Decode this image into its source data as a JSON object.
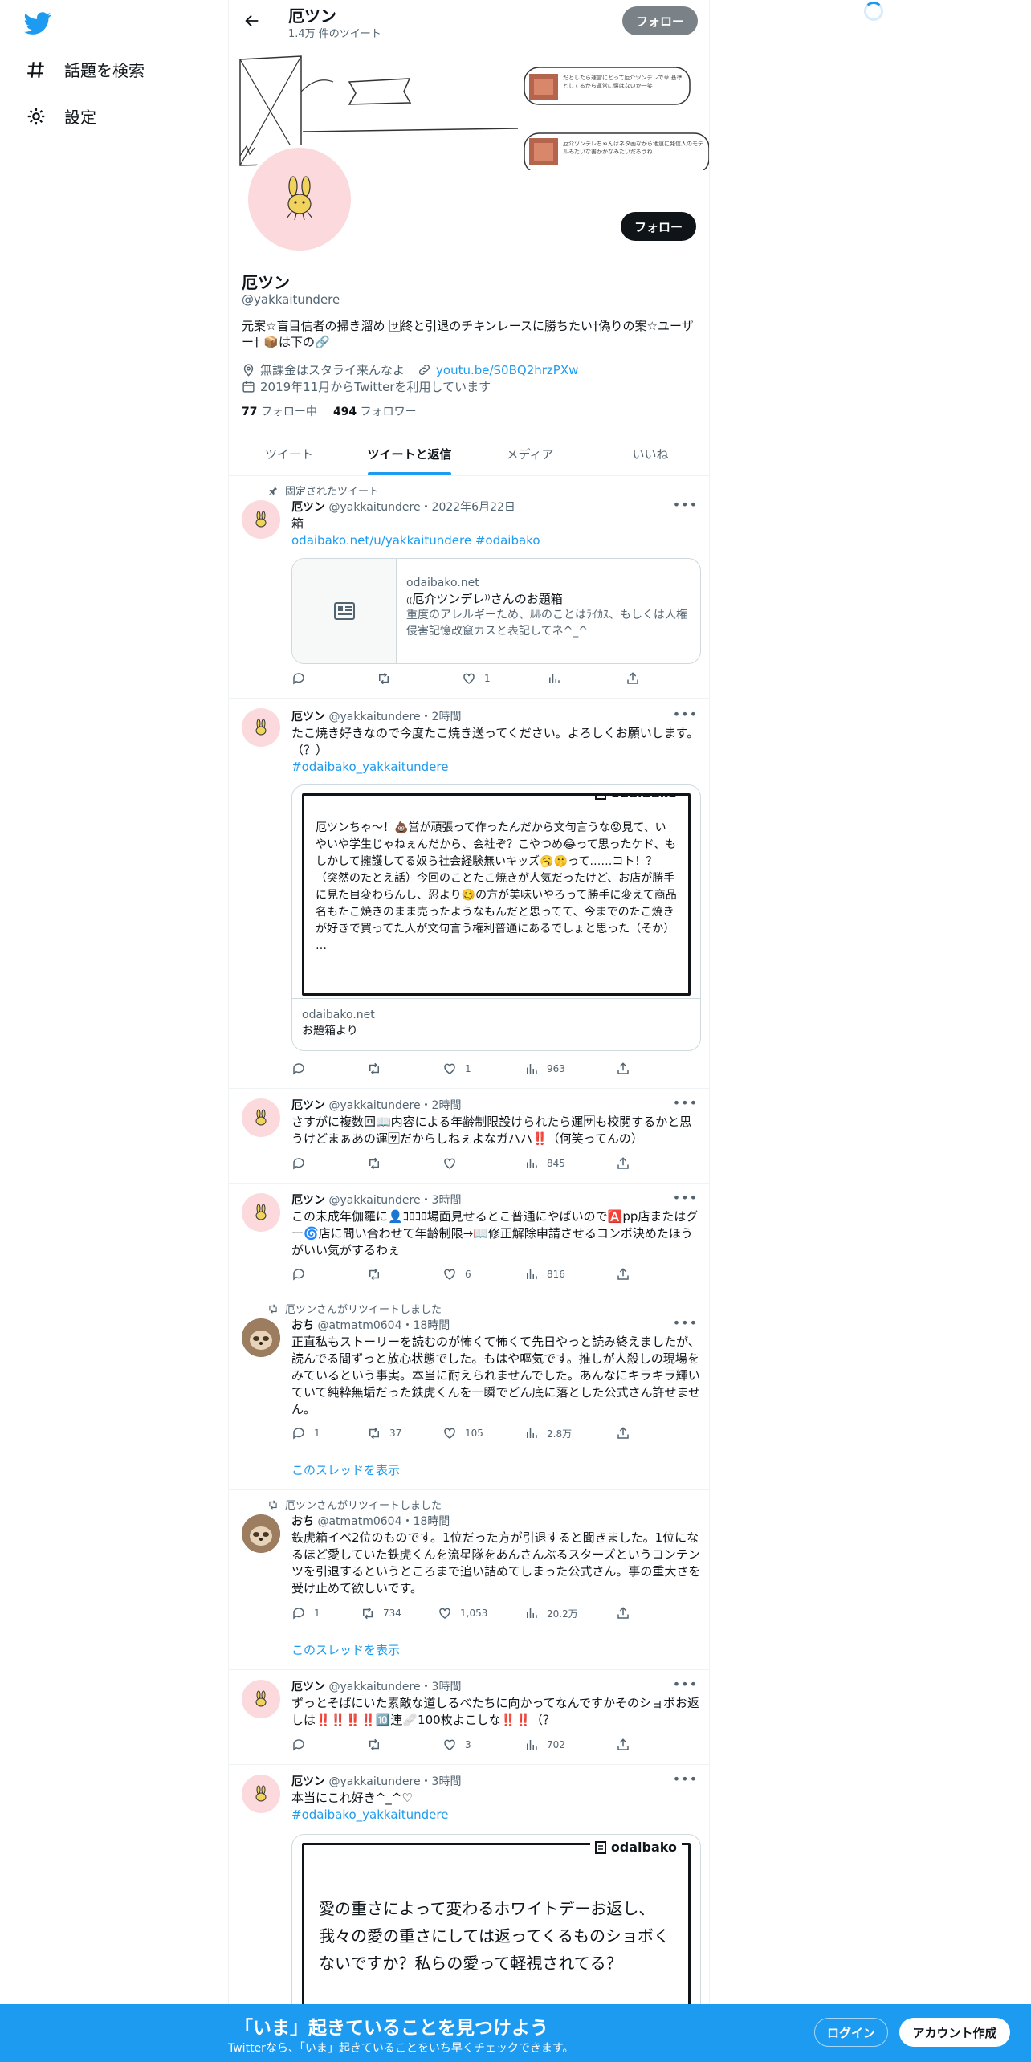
{
  "nav": {
    "explore": "話題を検索",
    "settings": "設定"
  },
  "header": {
    "name": "厄ツン",
    "tweet_count": "1.4万 件のツイート",
    "follow": "フォロー"
  },
  "banner": {
    "note1": "だとしたら運営にとって厄介ツンデレで草 基準としてるから運営に懐はないか一笑",
    "note2": "厄介ツンデレちゃんはネタ画ながら地道に発信人のモデルみたいな書かかなみたいだろうね"
  },
  "profile": {
    "name": "厄ツン",
    "handle": "@yakkaitundere",
    "bio": "元案☆盲目信者の掃き溜め 🈂終と引退のチキンレースに勝ちたい†偽りの案☆ユーザー† 📦は下の🔗",
    "location": "無課金はスタライ来んなよ",
    "url": "youtu.be/S0BQ2hrzPXw",
    "joined": "2019年11月からTwitterを利用しています",
    "following_count": "77",
    "following_label": "フォロー中",
    "followers_count": "494",
    "followers_label": "フォロワー",
    "follow": "フォロー"
  },
  "tabs": [
    "ツイート",
    "ツイートと返信",
    "メディア",
    "いいね"
  ],
  "tweets": {
    "t1": {
      "context": "固定されたツイート",
      "name": "厄ツン",
      "meta": "@yakkaitundere・2022年6月22日",
      "text": "箱",
      "link": "odaibako.net/u/yakkaitundere #odaibako",
      "card_domain": "odaibako.net",
      "card_title": "₍₍厄介ツンデレ⁾⁾さんのお題箱",
      "card_desc": "重度のアレルギーため、ﾙﾙのことはﾗｲｶｽ、もしくは人権侵害記憶改竄カスと表記してネ^_^",
      "reply": "",
      "retweet": "",
      "like": "1",
      "views": ""
    },
    "t2": {
      "name": "厄ツン",
      "meta": "@yakkaitundere・2時間",
      "text": "たこ焼き好きなので今度たこ焼き送ってください。よろしくお願いします。（？）",
      "link": "#odaibako_yakkaitundere",
      "odai_logo": "odaibako",
      "odai_text": "厄ツンちゃ〜！💩営が頑張って作ったんだから文句言うな😡見て、いやいや学生じゃねぇんだから、会社ぞ？こやつめ😂って思ったケド、もしかして擁護してる奴ら社会経験無いキッズ🥱🤫って……コト！？\n（突然のたとえ話）今回のことたこ焼きが人気だったけど、お店が勝手に見た目変わらんし、忍より🥴の方が美味いやろって勝手に変えて商品名もたこ焼きのまま売ったようなもんだと思ってて、今までのたこ焼きが好きで買ってた人が文句言う権利普通にあるでしょと思った（そか）\n…",
      "card_domain": "odaibako.net",
      "card_title": "お題箱より",
      "like": "1",
      "views": "963"
    },
    "t3": {
      "name": "厄ツン",
      "meta": "@yakkaitundere・2時間",
      "text": "さすがに複数回📖内容による年齢制限設けられたら運🈂も校閲するかと思うけどまぁあの運🈂だからしねぇよなガハハ‼️（何笑ってんの）",
      "views": "845"
    },
    "t4": {
      "name": "厄ツン",
      "meta": "@yakkaitundere・3時間",
      "text": "この未成年伽羅に👤ｺﾛｺﾛ場面見せるとこ普通にやばいので🅰️pp店またはグー🌀店に問い合わせて年齢制限→📖修正解除申請させるコンボ決めたほうがいい気がするわぇ",
      "like": "6",
      "views": "816"
    },
    "t5": {
      "context": "厄ツンさんがリツイートしました",
      "name": "おち",
      "meta": "@atmatm0604・18時間",
      "text": "正直私もストーリーを読むのが怖くて怖くて先日やっと読み終えましたが、読んでる間ずっと放心状態でした。もはや嘔気です。推しが人殺しの現場をみているという事実。本当に耐えられませんでした。あんなにキラキラ輝いていて純粋無垢だった鉄虎くんを一瞬でどん底に落とした公式さん許せません。",
      "reply": "1",
      "retweet": "37",
      "like": "105",
      "views": "2.8万",
      "show_thread": "このスレッドを表示"
    },
    "t6": {
      "context": "厄ツンさんがリツイートしました",
      "name": "おち",
      "meta": "@atmatm0604・18時間",
      "text": "鉄虎箱イベ2位のものです。1位だった方が引退すると聞きました。1位になるほど愛していた鉄虎くんを流星隊をあんさんぶるスターズというコンテンツを引退するというところまで追い詰めてしまった公式さん。事の重大さを受け止めて欲しいです。",
      "reply": "1",
      "retweet": "734",
      "like": "1,053",
      "views": "20.2万",
      "show_thread": "このスレッドを表示"
    },
    "t7": {
      "name": "厄ツン",
      "meta": "@yakkaitundere・3時間",
      "text": "ずっとそばにいた素敵な道しるべたちに向かってなんですかそのショボお返しは‼️‼️‼️‼️🔟連🩹100枚よこしな‼️‼️（？",
      "like": "3",
      "views": "702"
    },
    "t8": {
      "name": "厄ツン",
      "meta": "@yakkaitundere・3時間",
      "text": "本当にこれ好き^_^♡",
      "link": "#odaibako_yakkaitundere",
      "odai_logo": "odaibako",
      "odai_text": "愛の重さによって変わるホワイトデーお返し、我々の愛の重さにしては返ってくるものショボくないですか？私らの愛って軽視されてる？"
    }
  },
  "bottom": {
    "title": "「いま」起きていることを見つけよう",
    "subtitle": "Twitterなら、「いま」起きていることをいち早くチェックできます。",
    "login": "ログイン",
    "signup": "アカウント作成"
  },
  "colors": {
    "accent": "#1d9bf0",
    "text": "#0f1419",
    "muted": "#536471",
    "avatar_bg": "#fbd9dc"
  }
}
